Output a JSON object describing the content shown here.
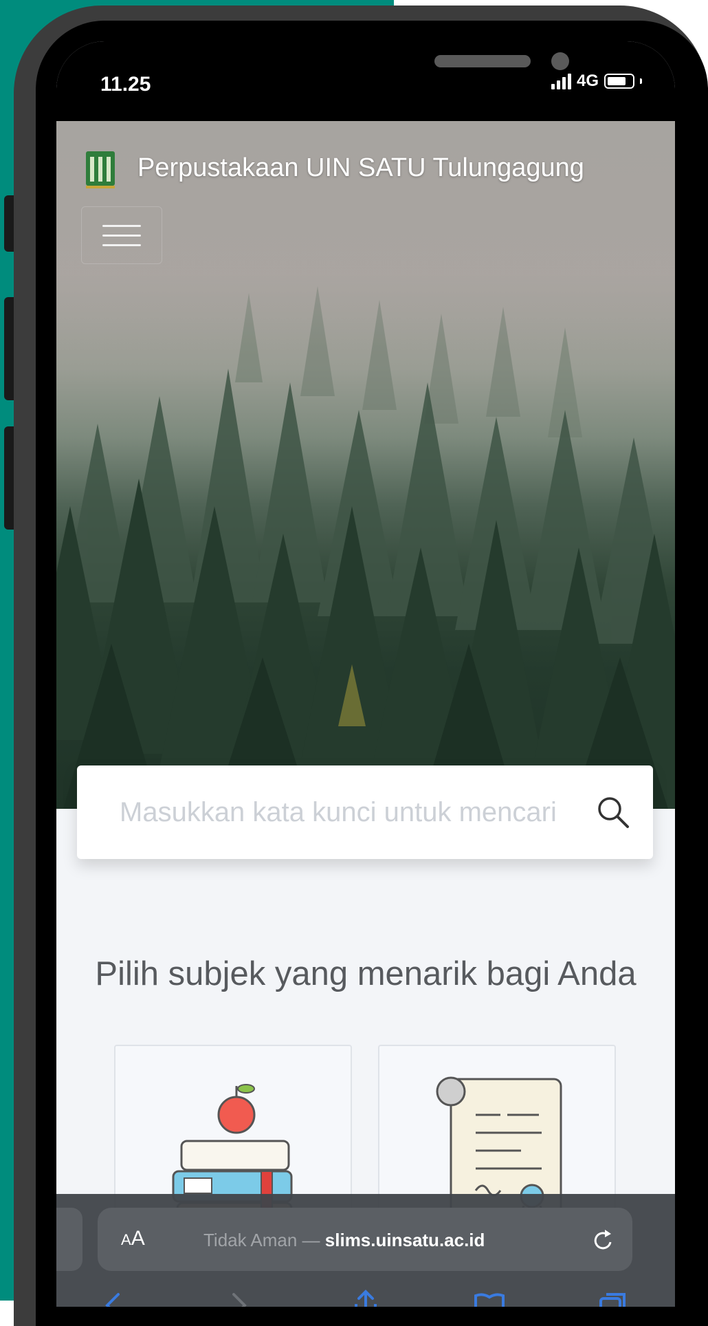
{
  "status_bar": {
    "time": "11.25",
    "network": "4G"
  },
  "header": {
    "title": "Perpustakaan UIN SATU Tulungagung",
    "logo_icon": "library-logo-icon",
    "menu_icon": "hamburger-menu-icon"
  },
  "search": {
    "placeholder": "Masukkan kata kunci untuk mencari",
    "icon": "search-icon"
  },
  "subjects": {
    "heading": "Pilih subjek yang menarik bagi Anda",
    "items": [
      {
        "icon": "books-apple-icon"
      },
      {
        "icon": "certificate-scroll-icon"
      }
    ]
  },
  "browser": {
    "aa_small": "A",
    "aa_large": "A",
    "security_label": "Tidak Aman —",
    "domain": "slims.uinsatu.ac.id",
    "reload_icon": "reload-icon"
  },
  "colors": {
    "teal_background": "#008c7d",
    "phone_frame": "#3c3c3c",
    "page_background": "#f3f5f8",
    "browser_bar": "#42464b",
    "toolbar_accent": "#3a7be0"
  }
}
